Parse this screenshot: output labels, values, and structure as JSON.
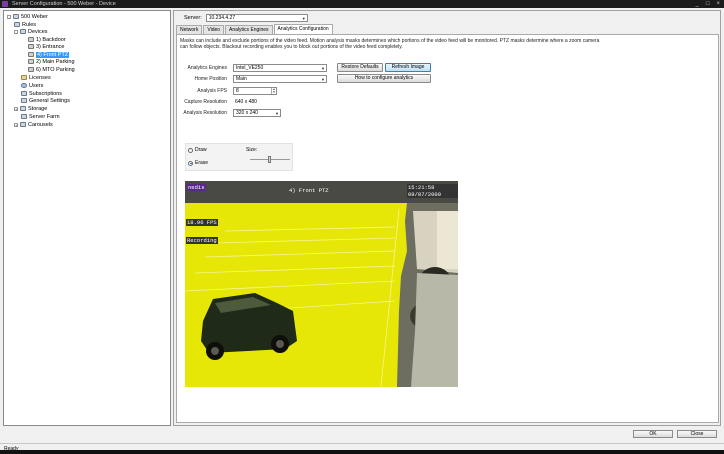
{
  "window": {
    "title": "Server Configuration - 500 Weber - Device",
    "buttons": [
      "_",
      "□",
      "×"
    ]
  },
  "tree": {
    "items": [
      {
        "label": "500 Weber",
        "toggle": "-",
        "icon": "server-icon"
      },
      {
        "label": "Rules",
        "toggle": "",
        "icon": "rules-icon"
      },
      {
        "label": "Devices",
        "toggle": "-",
        "icon": "devices-icon"
      },
      {
        "label": "1) Backdoor",
        "toggle": "",
        "icon": "camera-icon"
      },
      {
        "label": "3) Entrance",
        "toggle": "",
        "icon": "camera-icon"
      },
      {
        "label": "4) Front PTZ",
        "toggle": "",
        "icon": "camera-icon",
        "selected": true
      },
      {
        "label": "2) Main Parking",
        "toggle": "",
        "icon": "camera-icon"
      },
      {
        "label": "6) MTO Parking",
        "toggle": "",
        "icon": "camera-icon"
      },
      {
        "label": "Licenses",
        "toggle": "",
        "icon": "license-icon"
      },
      {
        "label": "Users",
        "toggle": "",
        "icon": "users-icon"
      },
      {
        "label": "Subscriptions",
        "toggle": "",
        "icon": "subscriptions-icon"
      },
      {
        "label": "General Settings",
        "toggle": "",
        "icon": "settings-icon"
      },
      {
        "label": "Storage",
        "toggle": "+",
        "icon": "storage-icon"
      },
      {
        "label": "Server Farm",
        "toggle": "",
        "icon": "server-farm-icon"
      },
      {
        "label": "Carousels",
        "toggle": "+",
        "icon": "carousels-icon"
      }
    ]
  },
  "server": {
    "label": "Server:",
    "value": "10.234.4.27"
  },
  "tabs": [
    "Network",
    "Video",
    "Analytics Engines",
    "Analytics Configuration"
  ],
  "active_tab": "Analytics Configuration",
  "description": "Masks can include and exclude portions of the video feed. Motion analysis masks determines which portions of the video feed will be monitored. PTZ masks determine where a zoom camera can follow objects. Blackout recording enables you to block out portions of the video feed completely.",
  "form": {
    "analytics_engines_label": "Analytics Engines",
    "analytics_engines_value": "Intel_VE250",
    "home_position_label": "Home Position",
    "home_position_value": "Main",
    "analysis_fps_label": "Analysis FPS",
    "analysis_fps_value": "8",
    "capture_resolution_label": "Capture Resolution",
    "capture_resolution_value": "640 x 480",
    "analysis_resolution_label": "Analysis Resolution",
    "analysis_resolution_value": "320 x 240",
    "restore_defaults": "Restore Defaults",
    "refresh_image": "Refresh Image",
    "how_to": "How to configure analytics"
  },
  "mask_tool": {
    "draw_label": "Draw",
    "erase_label": "Erase",
    "selected": "Erase",
    "size_label": "Size:",
    "size_level": 0.5
  },
  "video": {
    "logo_text": "nedis",
    "camera_label": "4) Front PTZ",
    "timestamp": "15:21:58 09/07/2009",
    "fps_text": "18.96 FPS",
    "record_text": "Recording",
    "mask_color": "#f0f000"
  },
  "footer": {
    "ok": "OK",
    "close": "Close",
    "status": "Ready"
  }
}
